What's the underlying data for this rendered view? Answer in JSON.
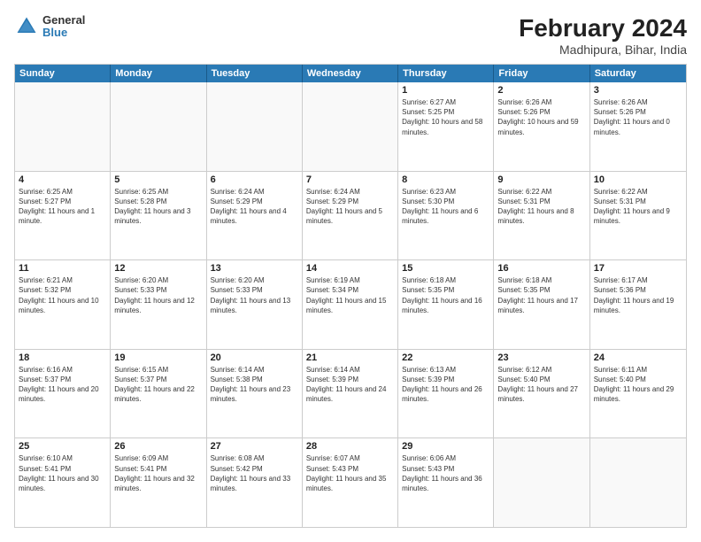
{
  "header": {
    "logo": {
      "general": "General",
      "blue": "Blue"
    },
    "title": "February 2024",
    "subtitle": "Madhipura, Bihar, India"
  },
  "calendar": {
    "weekdays": [
      "Sunday",
      "Monday",
      "Tuesday",
      "Wednesday",
      "Thursday",
      "Friday",
      "Saturday"
    ],
    "weeks": [
      [
        {
          "day": "",
          "info": ""
        },
        {
          "day": "",
          "info": ""
        },
        {
          "day": "",
          "info": ""
        },
        {
          "day": "",
          "info": ""
        },
        {
          "day": "1",
          "info": "Sunrise: 6:27 AM\nSunset: 5:25 PM\nDaylight: 10 hours and 58 minutes."
        },
        {
          "day": "2",
          "info": "Sunrise: 6:26 AM\nSunset: 5:26 PM\nDaylight: 10 hours and 59 minutes."
        },
        {
          "day": "3",
          "info": "Sunrise: 6:26 AM\nSunset: 5:26 PM\nDaylight: 11 hours and 0 minutes."
        }
      ],
      [
        {
          "day": "4",
          "info": "Sunrise: 6:25 AM\nSunset: 5:27 PM\nDaylight: 11 hours and 1 minute."
        },
        {
          "day": "5",
          "info": "Sunrise: 6:25 AM\nSunset: 5:28 PM\nDaylight: 11 hours and 3 minutes."
        },
        {
          "day": "6",
          "info": "Sunrise: 6:24 AM\nSunset: 5:29 PM\nDaylight: 11 hours and 4 minutes."
        },
        {
          "day": "7",
          "info": "Sunrise: 6:24 AM\nSunset: 5:29 PM\nDaylight: 11 hours and 5 minutes."
        },
        {
          "day": "8",
          "info": "Sunrise: 6:23 AM\nSunset: 5:30 PM\nDaylight: 11 hours and 6 minutes."
        },
        {
          "day": "9",
          "info": "Sunrise: 6:22 AM\nSunset: 5:31 PM\nDaylight: 11 hours and 8 minutes."
        },
        {
          "day": "10",
          "info": "Sunrise: 6:22 AM\nSunset: 5:31 PM\nDaylight: 11 hours and 9 minutes."
        }
      ],
      [
        {
          "day": "11",
          "info": "Sunrise: 6:21 AM\nSunset: 5:32 PM\nDaylight: 11 hours and 10 minutes."
        },
        {
          "day": "12",
          "info": "Sunrise: 6:20 AM\nSunset: 5:33 PM\nDaylight: 11 hours and 12 minutes."
        },
        {
          "day": "13",
          "info": "Sunrise: 6:20 AM\nSunset: 5:33 PM\nDaylight: 11 hours and 13 minutes."
        },
        {
          "day": "14",
          "info": "Sunrise: 6:19 AM\nSunset: 5:34 PM\nDaylight: 11 hours and 15 minutes."
        },
        {
          "day": "15",
          "info": "Sunrise: 6:18 AM\nSunset: 5:35 PM\nDaylight: 11 hours and 16 minutes."
        },
        {
          "day": "16",
          "info": "Sunrise: 6:18 AM\nSunset: 5:35 PM\nDaylight: 11 hours and 17 minutes."
        },
        {
          "day": "17",
          "info": "Sunrise: 6:17 AM\nSunset: 5:36 PM\nDaylight: 11 hours and 19 minutes."
        }
      ],
      [
        {
          "day": "18",
          "info": "Sunrise: 6:16 AM\nSunset: 5:37 PM\nDaylight: 11 hours and 20 minutes."
        },
        {
          "day": "19",
          "info": "Sunrise: 6:15 AM\nSunset: 5:37 PM\nDaylight: 11 hours and 22 minutes."
        },
        {
          "day": "20",
          "info": "Sunrise: 6:14 AM\nSunset: 5:38 PM\nDaylight: 11 hours and 23 minutes."
        },
        {
          "day": "21",
          "info": "Sunrise: 6:14 AM\nSunset: 5:39 PM\nDaylight: 11 hours and 24 minutes."
        },
        {
          "day": "22",
          "info": "Sunrise: 6:13 AM\nSunset: 5:39 PM\nDaylight: 11 hours and 26 minutes."
        },
        {
          "day": "23",
          "info": "Sunrise: 6:12 AM\nSunset: 5:40 PM\nDaylight: 11 hours and 27 minutes."
        },
        {
          "day": "24",
          "info": "Sunrise: 6:11 AM\nSunset: 5:40 PM\nDaylight: 11 hours and 29 minutes."
        }
      ],
      [
        {
          "day": "25",
          "info": "Sunrise: 6:10 AM\nSunset: 5:41 PM\nDaylight: 11 hours and 30 minutes."
        },
        {
          "day": "26",
          "info": "Sunrise: 6:09 AM\nSunset: 5:41 PM\nDaylight: 11 hours and 32 minutes."
        },
        {
          "day": "27",
          "info": "Sunrise: 6:08 AM\nSunset: 5:42 PM\nDaylight: 11 hours and 33 minutes."
        },
        {
          "day": "28",
          "info": "Sunrise: 6:07 AM\nSunset: 5:43 PM\nDaylight: 11 hours and 35 minutes."
        },
        {
          "day": "29",
          "info": "Sunrise: 6:06 AM\nSunset: 5:43 PM\nDaylight: 11 hours and 36 minutes."
        },
        {
          "day": "",
          "info": ""
        },
        {
          "day": "",
          "info": ""
        }
      ]
    ]
  }
}
